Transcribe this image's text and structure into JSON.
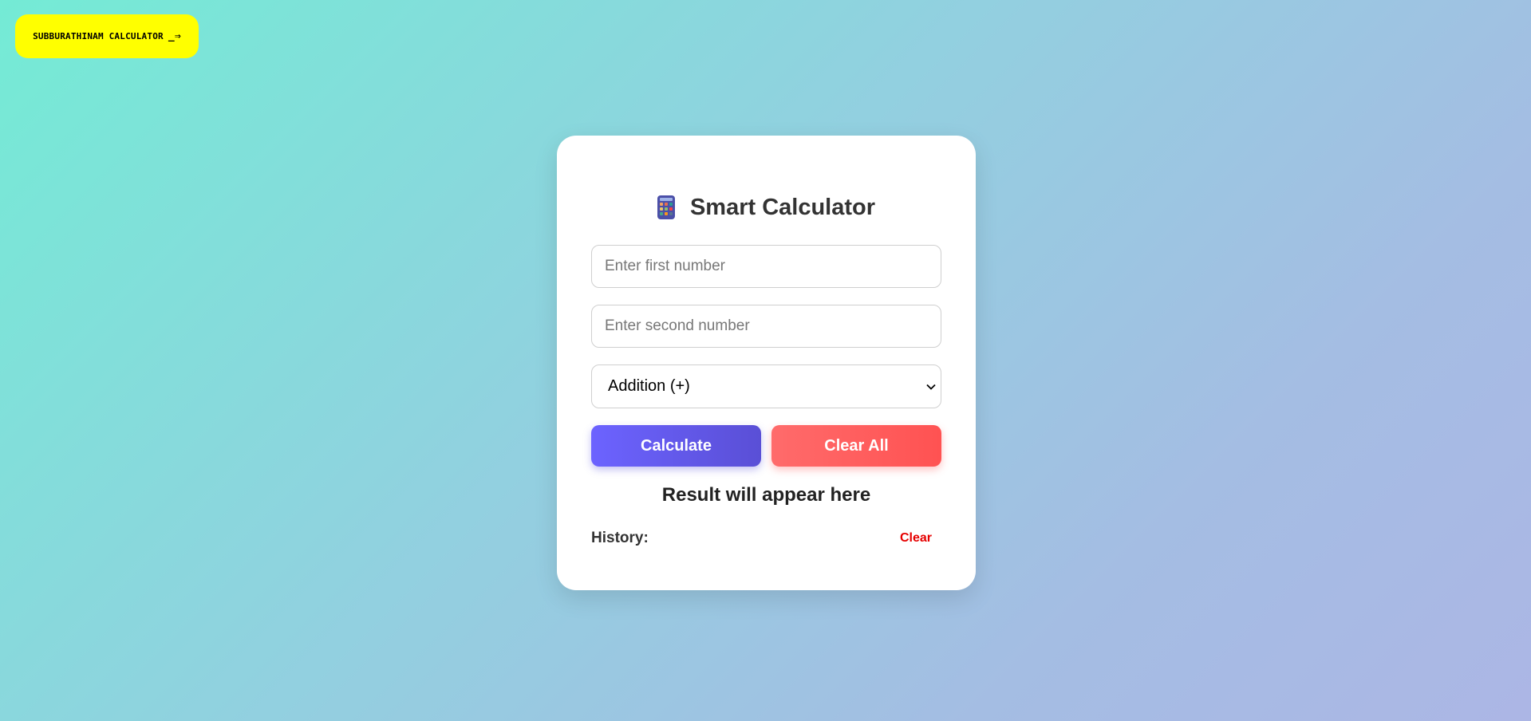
{
  "brand": {
    "label": "SUBBURATHINAM CALCULATOR",
    "arrow": "_⇒"
  },
  "calculator": {
    "title": "Smart Calculator",
    "icon": "calculator-icon",
    "first_input": {
      "value": "",
      "placeholder": "Enter first number"
    },
    "second_input": {
      "value": "",
      "placeholder": "Enter second number"
    },
    "operation": {
      "selected": "Addition (+)"
    },
    "calculate_label": "Calculate",
    "clear_all_label": "Clear All",
    "result_text": "Result will appear here",
    "history": {
      "label": "History:",
      "clear_label": "Clear"
    }
  },
  "colors": {
    "brand_pill": "#ffff00",
    "calculate_button": "#6c63ff",
    "clear_all_button": "#ff5b5b",
    "history_clear": "#e60000"
  }
}
